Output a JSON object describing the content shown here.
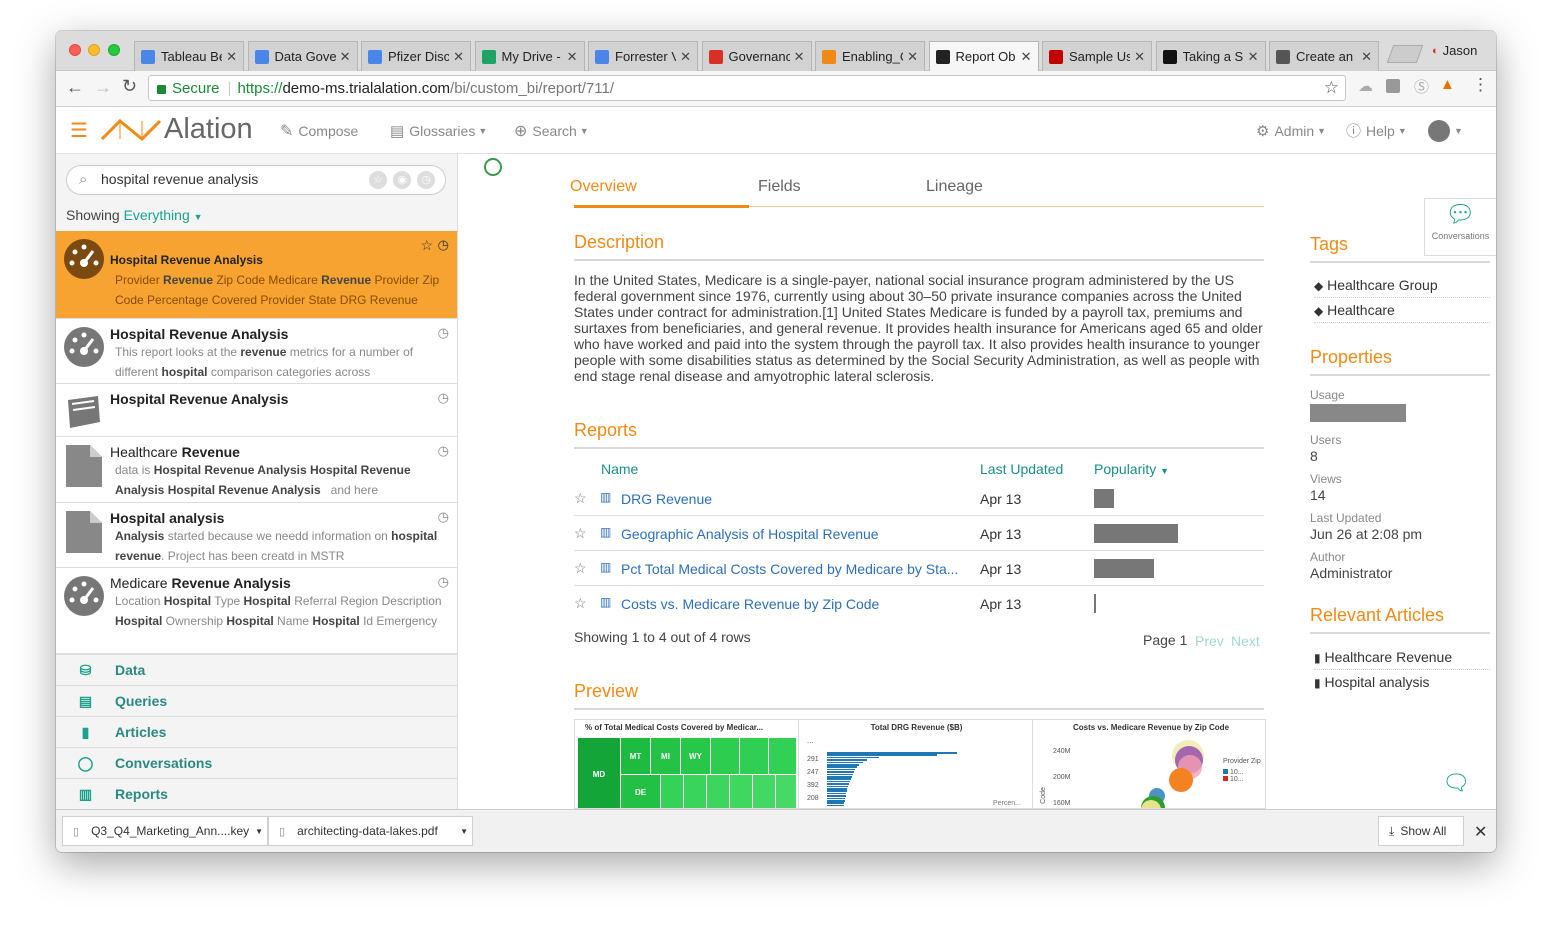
{
  "browser": {
    "tabs": [
      {
        "label": "Tableau Be",
        "icon": "doc-icon",
        "color": "#4a86e8"
      },
      {
        "label": "Data Gove",
        "icon": "doc-icon",
        "color": "#4a86e8"
      },
      {
        "label": "Pfizer Disc",
        "icon": "doc-icon",
        "color": "#4a86e8"
      },
      {
        "label": "My Drive -",
        "icon": "drive-icon",
        "color": "#1da462"
      },
      {
        "label": "Forrester V",
        "icon": "doc-icon",
        "color": "#4a86e8"
      },
      {
        "label": "Governanc",
        "icon": "pdf-icon",
        "color": "#d93025"
      },
      {
        "label": "Enabling_C",
        "icon": "alation-icon",
        "color": "#f08a16"
      },
      {
        "label": "Report Ob",
        "icon": "alation-icon",
        "color": "#222222"
      },
      {
        "label": "Sample Us",
        "icon": "sample-icon",
        "color": "#c00000"
      },
      {
        "label": "Taking a S",
        "icon": "g-icon",
        "color": "#111111"
      },
      {
        "label": "Create an",
        "icon": "create-icon",
        "color": "#555555"
      }
    ],
    "profile": "Jason",
    "secure_label": "Secure",
    "url_scheme": "https://",
    "url_host": "demo-ms.trialalation.com",
    "url_path": "/bi/custom_bi/report/711/"
  },
  "app": {
    "logo": "Alation",
    "nav": {
      "compose": "Compose",
      "glossaries": "Glossaries",
      "search": "Search",
      "admin": "Admin",
      "help": "Help"
    }
  },
  "search": {
    "query": "hospital revenue analysis",
    "showing_label": "Showing",
    "showing_value": "Everything"
  },
  "results": [
    {
      "title": "Hospital Revenue Analysis",
      "snippet_html": "Provider <b>Revenue</b> Zip Code Medicare <b>Revenue</b> Provider Zip Code Percentage Covered Provider State DRG Revenue"
    },
    {
      "title": "Hospital Revenue Analysis",
      "snippet_html": "This report looks at the <b>revenue</b> metrics for a number of different <b>hospital</b> comparison categories across"
    },
    {
      "title": "Hospital Revenue Analysis",
      "snippet_html": ""
    },
    {
      "title_plain": "Healthcare ",
      "title": "Revenue",
      "snippet_html": "data is <b>Hospital Revenue Analysis Hospital Revenue Analysis Hospital Revenue Analysis</b> &nbsp; and here"
    },
    {
      "title": "Hospital analysis",
      "snippet_html": "<b>Analysis</b> started because we needd information on <b>hospital revenue</b>. Project has been creatd in MSTR"
    },
    {
      "title_plain": "Medicare ",
      "title": "Revenue Analysis",
      "snippet_html": "Location <b>Hospital</b> Type <b>Hospital</b> Referral Region Description <b>Hospital</b> Ownership <b>Hospital</b> Name <b>Hospital</b> Id Emergency"
    }
  ],
  "categories": [
    "Data",
    "Queries",
    "Articles",
    "Conversations",
    "Reports"
  ],
  "main": {
    "tabs": [
      "Overview",
      "Fields",
      "Lineage"
    ],
    "description_title": "Description",
    "description": "In the United States, Medicare is a single-payer, national social insurance program administered by the US federal government since 1976, currently using about 30–50 private insurance companies across the United States under contract for administration.[1] United States Medicare is funded by a payroll tax, premiums and surtaxes from beneficiaries, and general revenue. It provides health insurance for Americans aged 65 and older who have worked and paid into the system through the payroll tax. It also provides health insurance to younger people with some disabilities status as determined by the Social Security Administration, as well as people with end stage renal disease and amyotrophic lateral sclerosis.",
    "reports_title": "Reports",
    "columns": {
      "name": "Name",
      "updated": "Last Updated",
      "popularity": "Popularity"
    },
    "reports": [
      {
        "name": "DRG Revenue",
        "updated": "Apr 13",
        "popularity": 0.2
      },
      {
        "name": "Geographic Analysis of Hospital Revenue",
        "updated": "Apr 13",
        "popularity": 0.84
      },
      {
        "name": "Pct Total Medical Costs Covered by Medicare by Sta...",
        "updated": "Apr 13",
        "popularity": 0.6
      },
      {
        "name": "Costs vs. Medicare Revenue by Zip Code",
        "updated": "Apr 13",
        "popularity": 0.02
      }
    ],
    "showing_rows": "Showing 1 to 4 out of 4 rows",
    "page": "Page 1",
    "prev": "Prev",
    "next": "Next",
    "preview_title": "Preview",
    "preview": {
      "p1_title": "% of Total Medical Costs Covered by Medicar...",
      "p2_title": "Total DRG Revenue ($B)",
      "p3_title": "Costs vs. Medicare Revenue by Zip Code",
      "states": [
        "MD",
        "MT",
        "MI",
        "WY",
        "DE"
      ],
      "p2_ellipsis": "...",
      "p2_ticks": [
        "291",
        "247",
        "392",
        "208"
      ],
      "p2_label": "Percen...",
      "p3_ticks": [
        "240M",
        "200M",
        "160M"
      ],
      "p3_axis": "Code",
      "p3_legend_title": "Provider Zip",
      "p3_legend": [
        "10...",
        "10..."
      ]
    }
  },
  "right": {
    "conversations": "Conversations",
    "tags_title": "Tags",
    "tags": [
      "Healthcare Group",
      "Healthcare"
    ],
    "properties_title": "Properties",
    "usage_label": "Usage",
    "users_label": "Users",
    "users": "8",
    "views_label": "Views",
    "views": "14",
    "last_updated_label": "Last Updated",
    "last_updated": "Jun 26 at 2:08 pm",
    "author_label": "Author",
    "author": "Administrator",
    "articles_title": "Relevant Articles",
    "articles": [
      "Healthcare Revenue",
      "Hospital analysis"
    ]
  },
  "downloads": {
    "items": [
      "Q3_Q4_Marketing_Ann....key",
      "architecting-data-lakes.pdf"
    ],
    "show_all": "Show All"
  },
  "colors": {
    "accent": "#f08a16",
    "teal": "#1aa28e",
    "link": "#2d6fb7"
  }
}
